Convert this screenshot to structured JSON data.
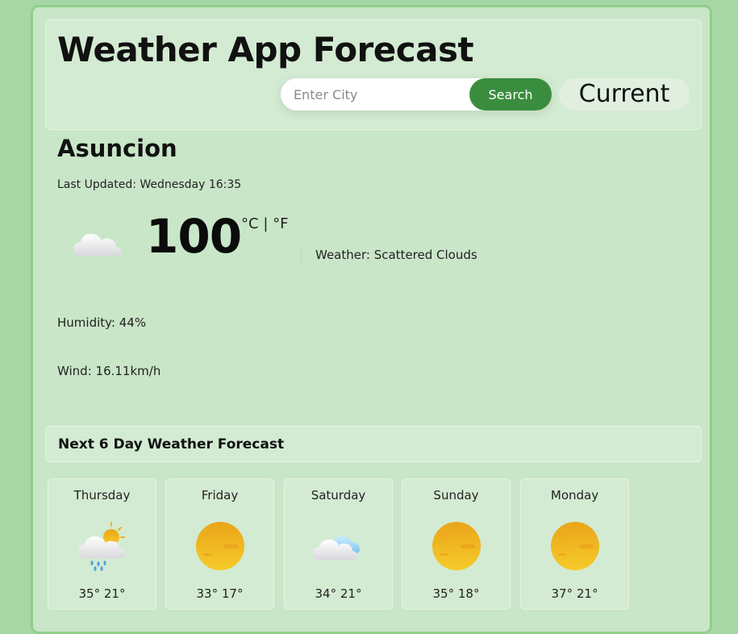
{
  "header": {
    "title": "Weather App Forecast",
    "search_placeholder": "Enter City",
    "search_button_label": "Search",
    "current_button_label": "Current"
  },
  "current": {
    "city": "Asuncion",
    "last_updated": "Last Updated: Wednesday 16:35",
    "temperature": "100",
    "unit_celsius": "°C",
    "unit_separator": "|",
    "unit_fahrenheit": "°F",
    "weather": "Weather: Scattered Clouds",
    "humidity": "Humidity: 44%",
    "wind": "Wind: 16.11km/h",
    "icon": "cloud-icon"
  },
  "forecast": {
    "heading": "Next 6 Day Weather Forecast",
    "days": [
      {
        "day": "Thursday",
        "temps": "35° 21°",
        "icon": "rain-sun-cloud-icon"
      },
      {
        "day": "Friday",
        "temps": "33° 17°",
        "icon": "sun-icon"
      },
      {
        "day": "Saturday",
        "temps": "34° 21°",
        "icon": "cloud-icon"
      },
      {
        "day": "Sunday",
        "temps": "35° 18°",
        "icon": "sun-icon"
      },
      {
        "day": "Monday",
        "temps": "37° 21°",
        "icon": "sun-icon"
      }
    ]
  },
  "colors": {
    "page_background": "#a7d7a4",
    "panel_background": "#c9e6c8",
    "card_background": "#d3ebd2",
    "accent_green": "#3a8d3e",
    "sun_yellow": "#f2b21b"
  }
}
